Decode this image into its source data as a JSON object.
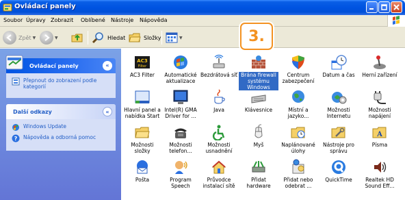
{
  "window": {
    "title": "Ovládací panely"
  },
  "menu": [
    "Soubor",
    "Úpravy",
    "Zobrazit",
    "Oblíbené",
    "Nástroje",
    "Nápověda"
  ],
  "toolbar": {
    "back": "Zpět",
    "search": "Hledat",
    "folders": "Složky"
  },
  "sidebar": {
    "control_panel": {
      "title": "Ovládací panely",
      "link": "Přepnout do zobrazení podle kategorií"
    },
    "other": {
      "title": "Další odkazy",
      "links": [
        "Windows Update",
        "Nápověda a odborná pomoc"
      ]
    }
  },
  "badge": "3.",
  "items": [
    [
      "AC3 Filter",
      "Automatické aktualizace",
      "Bezdrátová síť",
      "Brána firewall systému Windows",
      "Centrum zabezpečení",
      "Datum a čas",
      "Herní zařízení"
    ],
    [
      "Hlavní panel a nabídka Start",
      "Intel(R) GMA Driver for ...",
      "Java",
      "Klávesnice",
      "Místní a jazyko...",
      "Možnosti Internetu",
      "Možnosti napájení"
    ],
    [
      "Možnosti složky",
      "Možnosti telefon...",
      "Možnosti usnadnění",
      "Myš",
      "Naplánované úlohy",
      "Nástroje pro správu",
      "Písma"
    ],
    [
      "Pošta",
      "Program Speech",
      "Průvodce instalací sítě",
      "Přidat hardware",
      "Přidat nebo odebrat ...",
      "QuickTime",
      "Realtek HD Sound Eff..."
    ]
  ],
  "selected_item": "Brána firewall systému Windows"
}
